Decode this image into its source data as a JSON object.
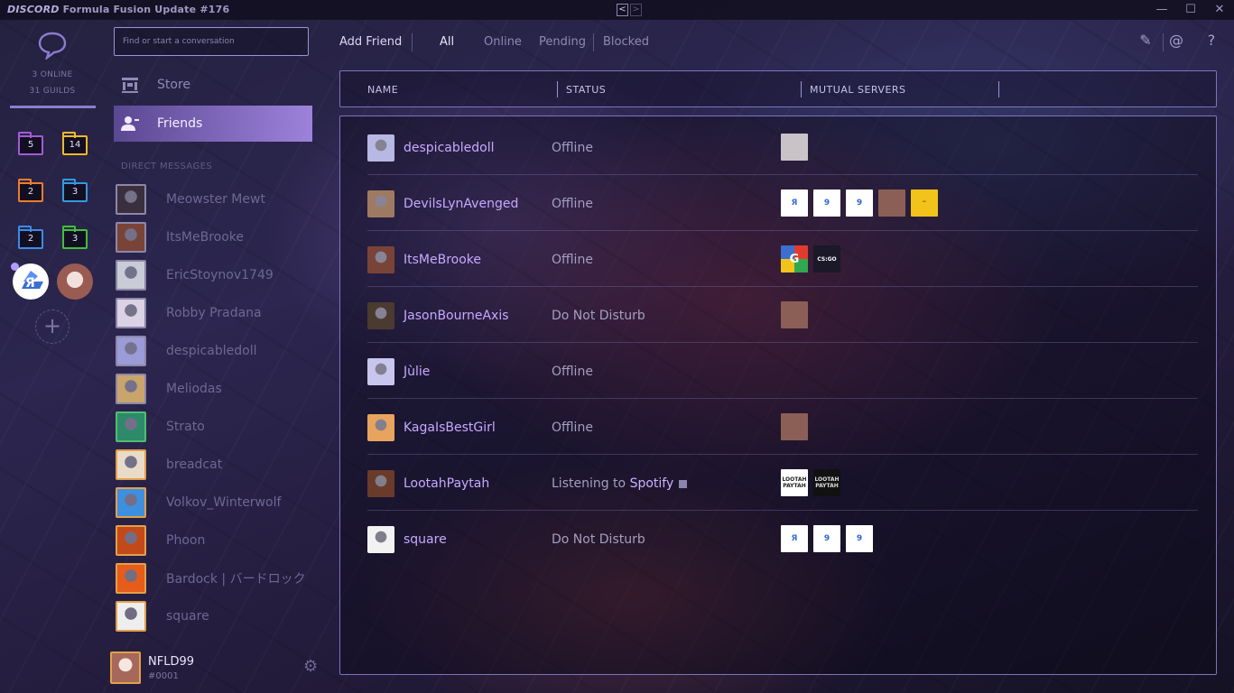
{
  "titlebar": {
    "brand": "DISCORD",
    "title": "Formula Fusion Update #176",
    "back_arrow": "<",
    "forward_arrow": ">",
    "minimize": "—",
    "maximize": "☐",
    "close": "✕"
  },
  "guilds": {
    "online": "3 ONLINE",
    "guild_count": "31 GUILDS",
    "folders": [
      {
        "count": "5",
        "color": "#a55ad6"
      },
      {
        "count": "14",
        "color": "#f0b92c"
      },
      {
        "count": "2",
        "color": "#ef7d2b"
      },
      {
        "count": "3",
        "color": "#3399e0"
      },
      {
        "count": "2",
        "color": "#3b8de8"
      },
      {
        "count": "3",
        "color": "#42c03a"
      }
    ],
    "add_server": "+"
  },
  "channels": {
    "search_placeholder": "Find or start a conversation",
    "store": "Store",
    "friends": "Friends",
    "dm_header": "DIRECT MESSAGES",
    "dms": [
      {
        "name": "Meowster Mewt",
        "color": "#3a2f3c"
      },
      {
        "name": "ItsMeBrooke",
        "color": "#7a4338"
      },
      {
        "name": "EricStoynov1749",
        "color": "#c9ccd6"
      },
      {
        "name": "Robby Pradana",
        "color": "#dcd2e6"
      },
      {
        "name": "despicabledoll",
        "color": "#9b9bd8"
      },
      {
        "name": "Meliodas",
        "color": "#c9a56b"
      },
      {
        "name": "Strato",
        "color": "#2e8a6a"
      },
      {
        "name": "breadcat",
        "color": "#e8dcc8"
      },
      {
        "name": "Volkov_Winterwolf",
        "color": "#3d8fe0"
      },
      {
        "name": "Phoon",
        "color": "#c24a1a"
      },
      {
        "name": "Bardock | バードロック",
        "color": "#e65c1a"
      },
      {
        "name": "square",
        "color": "#eeeeee"
      }
    ],
    "user": {
      "name": "NFLD99",
      "tag": "#0001"
    }
  },
  "topbar": {
    "add_friend": "Add Friend",
    "tabs": [
      "All",
      "Online",
      "Pending",
      "Blocked"
    ],
    "new_group_icon": "✎",
    "mentions_icon": "@",
    "help_icon": "?"
  },
  "columns": {
    "name": "NAME",
    "status": "STATUS",
    "mutual": "MUTUAL SERVERS"
  },
  "friends": [
    {
      "name": "despicabledoll",
      "status": "Offline",
      "avatar_color": "#b7b8e3",
      "mutuals": [
        {
          "label": "",
          "bg": "#c9c3c8",
          "fg": "#555"
        }
      ]
    },
    {
      "name": "DevilsLynAvenged",
      "status": "Offline",
      "avatar_color": "#9f7a62",
      "mutuals": [
        {
          "label": "Я",
          "bg": "#ffffff",
          "fg": "#3b6fd0"
        },
        {
          "label": "9",
          "bg": "#ffffff",
          "fg": "#2f66c8"
        },
        {
          "label": "9",
          "bg": "#ffffff",
          "fg": "#2f66c8"
        },
        {
          "label": "",
          "bg": "#8c5f56",
          "fg": "#fff"
        },
        {
          "label": "ᵕ",
          "bg": "#f2c31a",
          "fg": "#7a5b00"
        }
      ]
    },
    {
      "name": "ItsMeBrooke",
      "status": "Offline",
      "avatar_color": "#7a4338",
      "mutuals": [
        {
          "label": "G",
          "bg": "#e23b2e",
          "fg": "#fff"
        },
        {
          "label": "CS:GO",
          "bg": "#1b1828",
          "fg": "#ffffff"
        }
      ]
    },
    {
      "name": "JasonBourneAxis",
      "status": "Do Not Disturb",
      "avatar_color": "#4a3a30",
      "mutuals": [
        {
          "label": "",
          "bg": "#8c5f56",
          "fg": "#fff"
        }
      ]
    },
    {
      "name": "Jùlie",
      "status": "Offline",
      "avatar_color": "#c8c6ee",
      "mutuals": []
    },
    {
      "name": "KagaIsBestGirl",
      "status": "Offline",
      "avatar_color": "#e8a45e",
      "mutuals": [
        {
          "label": "",
          "bg": "#8c5f56",
          "fg": "#fff"
        }
      ]
    },
    {
      "name": "LootahPaytah",
      "status": "Listening to ",
      "game": "Spotify",
      "avatar_color": "#6a3a2a",
      "mutuals": [
        {
          "label": "LOOTAH PAYTAH",
          "bg": "#ffffff",
          "fg": "#222"
        },
        {
          "label": "LOOTAH PAYTAH",
          "bg": "#111111",
          "fg": "#ddd"
        }
      ]
    },
    {
      "name": "square",
      "status": "Do Not Disturb",
      "avatar_color": "#f2f2f2",
      "mutuals": [
        {
          "label": "Я",
          "bg": "#ffffff",
          "fg": "#3b6fd0"
        },
        {
          "label": "9",
          "bg": "#ffffff",
          "fg": "#2f66c8"
        },
        {
          "label": "9",
          "bg": "#ffffff",
          "fg": "#2f66c8"
        }
      ]
    }
  ]
}
